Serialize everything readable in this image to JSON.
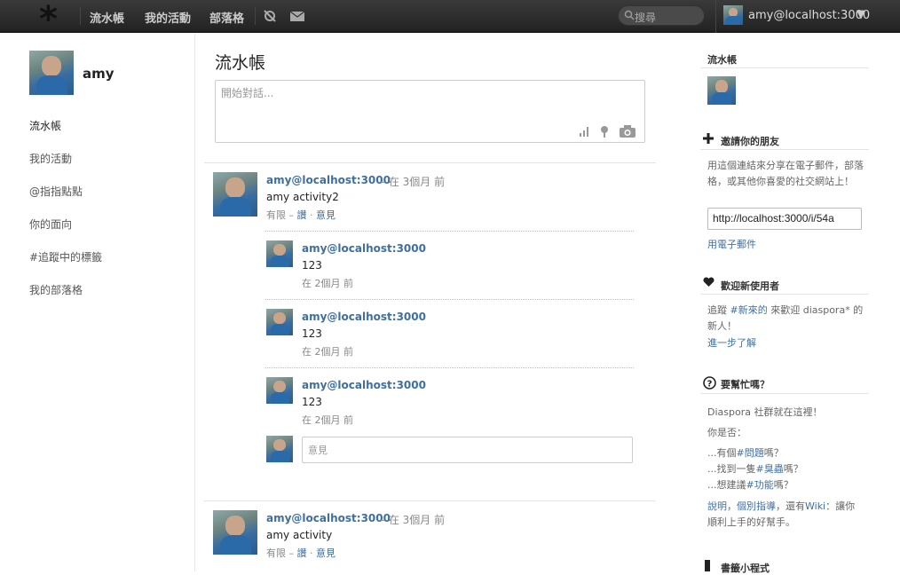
{
  "header": {
    "logo": "*",
    "nav": [
      "流水帳",
      "我的活動",
      "部落格"
    ],
    "search_placeholder": "搜尋",
    "user": "amy@localhost:3000",
    "caret": "▼"
  },
  "left": {
    "profile_name": "amy",
    "nav": [
      "流水帳",
      "我的活動",
      "@指指點點",
      "你的面向",
      "#追蹤中的標籤",
      "我的部落格"
    ]
  },
  "main": {
    "title": "流水帳",
    "composer_placeholder": "開始對話...",
    "posts": [
      {
        "author": "amy@localhost:3000",
        "time": "在 3個月 前",
        "text": "amy activity2",
        "visibility": "有限",
        "like": "讚",
        "comment": "意見",
        "comments": [
          {
            "author": "amy@localhost:3000",
            "text": "123",
            "time": "在 2個月 前"
          },
          {
            "author": "amy@localhost:3000",
            "text": "123",
            "time": "在 2個月 前"
          },
          {
            "author": "amy@localhost:3000",
            "text": "123",
            "time": "在 2個月 前"
          }
        ],
        "comment_placeholder": "意見"
      },
      {
        "author": "amy@localhost:3000",
        "time": "在 3個月 前",
        "text": "amy activity",
        "visibility": "有限",
        "like": "讚",
        "comment": "意見"
      }
    ]
  },
  "right": {
    "stream_title": "流水帳",
    "invite_title": "邀請你的朋友",
    "invite_text": "用這個連結來分享在電子郵件，部落格，或其他你喜愛的社交網站上！",
    "invite_url": "http://localhost:3000/i/54a",
    "invite_email": "用電子郵件",
    "welcome_title": "歡迎新使用者",
    "welcome_pre": "追蹤 ",
    "welcome_tag": "#新來的",
    "welcome_post": " 來歡迎 diaspora* 的新人！",
    "learn_more": "進一步了解",
    "help_title": "要幫忙嗎？",
    "help_line1": "Diaspora 社群就在這裡！",
    "help_line2": "你是否：",
    "help_q1_pre": "...有個",
    "help_q1_tag": "#問題",
    "help_q1_post": "嗎？",
    "help_q2_pre": "...找到一隻",
    "help_q2_tag": "#臭蟲",
    "help_q2_post": "嗎？",
    "help_q3_pre": "...想建議",
    "help_q3_tag": "#功能",
    "help_q3_post": "嗎？",
    "help_footer_a": "說明",
    "help_footer_sep1": "，",
    "help_footer_b": "個別指導",
    "help_footer_sep2": "，還有",
    "help_footer_c": "Wiki",
    "help_footer_rest": "：讓你順利上手的好幫手。",
    "bookmarklet_title": "書籤小程式"
  },
  "colors": {
    "link": "#3f6f9f",
    "header": "#2b2b2b"
  }
}
